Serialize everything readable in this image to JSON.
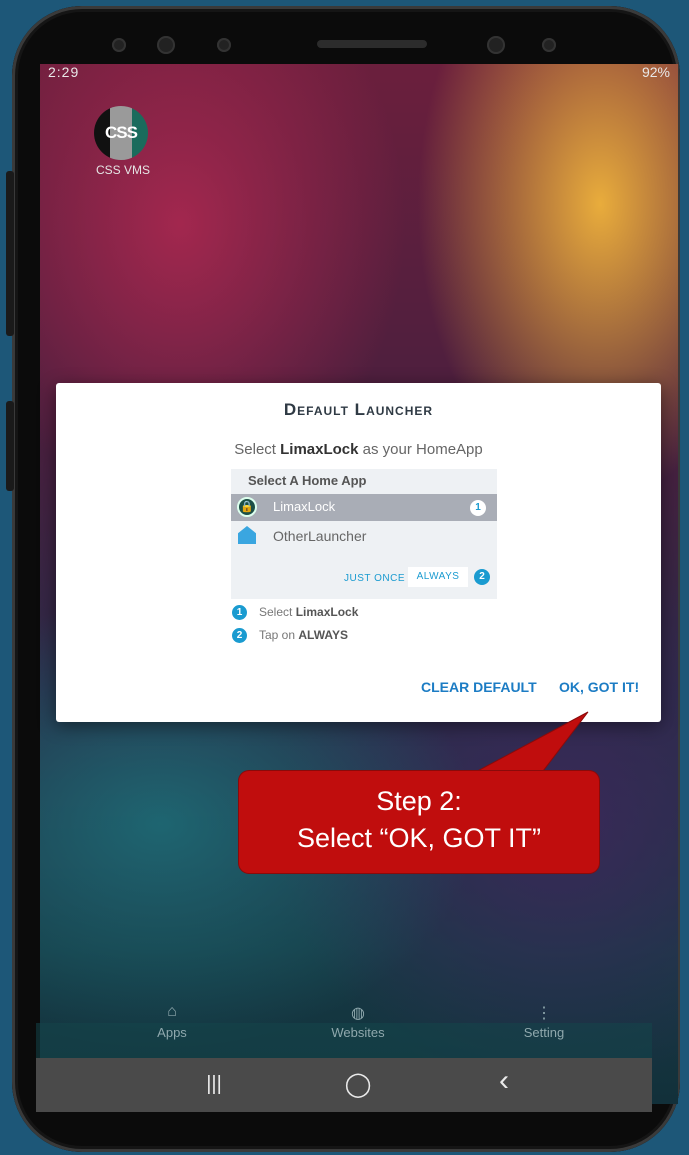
{
  "status": {
    "time": "2:29",
    "right_text": "92%"
  },
  "home": {
    "app_icon_text": "CSS",
    "app_label": "CSS VMS"
  },
  "dialog": {
    "title": "Default Launcher",
    "subtitle_prefix": "Select ",
    "subtitle_app": "LimaxLock",
    "subtitle_suffix": " as your HomeApp",
    "preview": {
      "heading": "Select A Home App",
      "option1": "LimaxLock",
      "option1_badge": "1",
      "option2": "OtherLauncher",
      "just_once": "JUST ONCE",
      "always": "ALWAYS",
      "always_badge": "2"
    },
    "steps": [
      {
        "num": "1",
        "prefix": "Select ",
        "bold": "LimaxLock"
      },
      {
        "num": "2",
        "prefix": "Tap on ",
        "bold": "ALWAYS"
      }
    ],
    "buttons": {
      "clear_default": "CLEAR DEFAULT",
      "ok": "OK, GOT IT!"
    }
  },
  "callout": {
    "line1": "Step 2:",
    "line2": "Select “OK, GOT IT”",
    "color": "#c00d0d"
  },
  "tabs": [
    {
      "label": "Apps",
      "icon": "home-icon"
    },
    {
      "label": "Websites",
      "icon": "globe-icon"
    },
    {
      "label": "Setting",
      "icon": "more-vertical-icon"
    }
  ],
  "nav": {
    "recents": "|||",
    "home": "◯",
    "back": "‹"
  },
  "colors": {
    "accent": "#1a9bd0",
    "button_text": "#1c7cc4"
  }
}
